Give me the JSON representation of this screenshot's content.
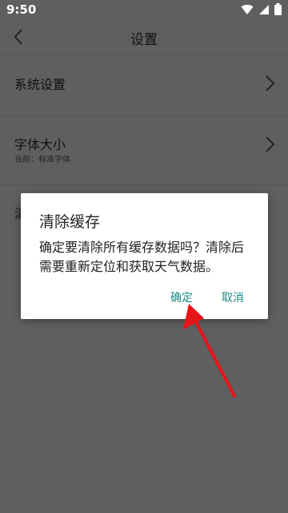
{
  "status": {
    "time": "9:50",
    "icons": [
      "wifi-icon",
      "signal-icon",
      "battery-icon"
    ]
  },
  "header": {
    "title": "设置"
  },
  "settings": {
    "items": [
      {
        "label": "系统设置"
      },
      {
        "label": "字体大小",
        "sub": "当前：标准字体"
      },
      {
        "label": "清"
      }
    ]
  },
  "dialog": {
    "title": "清除缓存",
    "message": "确定要清除所有缓存数据吗？清除后需要重新定位和获取天气数据。",
    "confirm": "确定",
    "cancel": "取消"
  },
  "colors": {
    "overlay_bg": "#5f5f5f",
    "dialog_bg": "#ffffff",
    "button_text": "#1a8a84",
    "arrow": "#e8141b"
  }
}
